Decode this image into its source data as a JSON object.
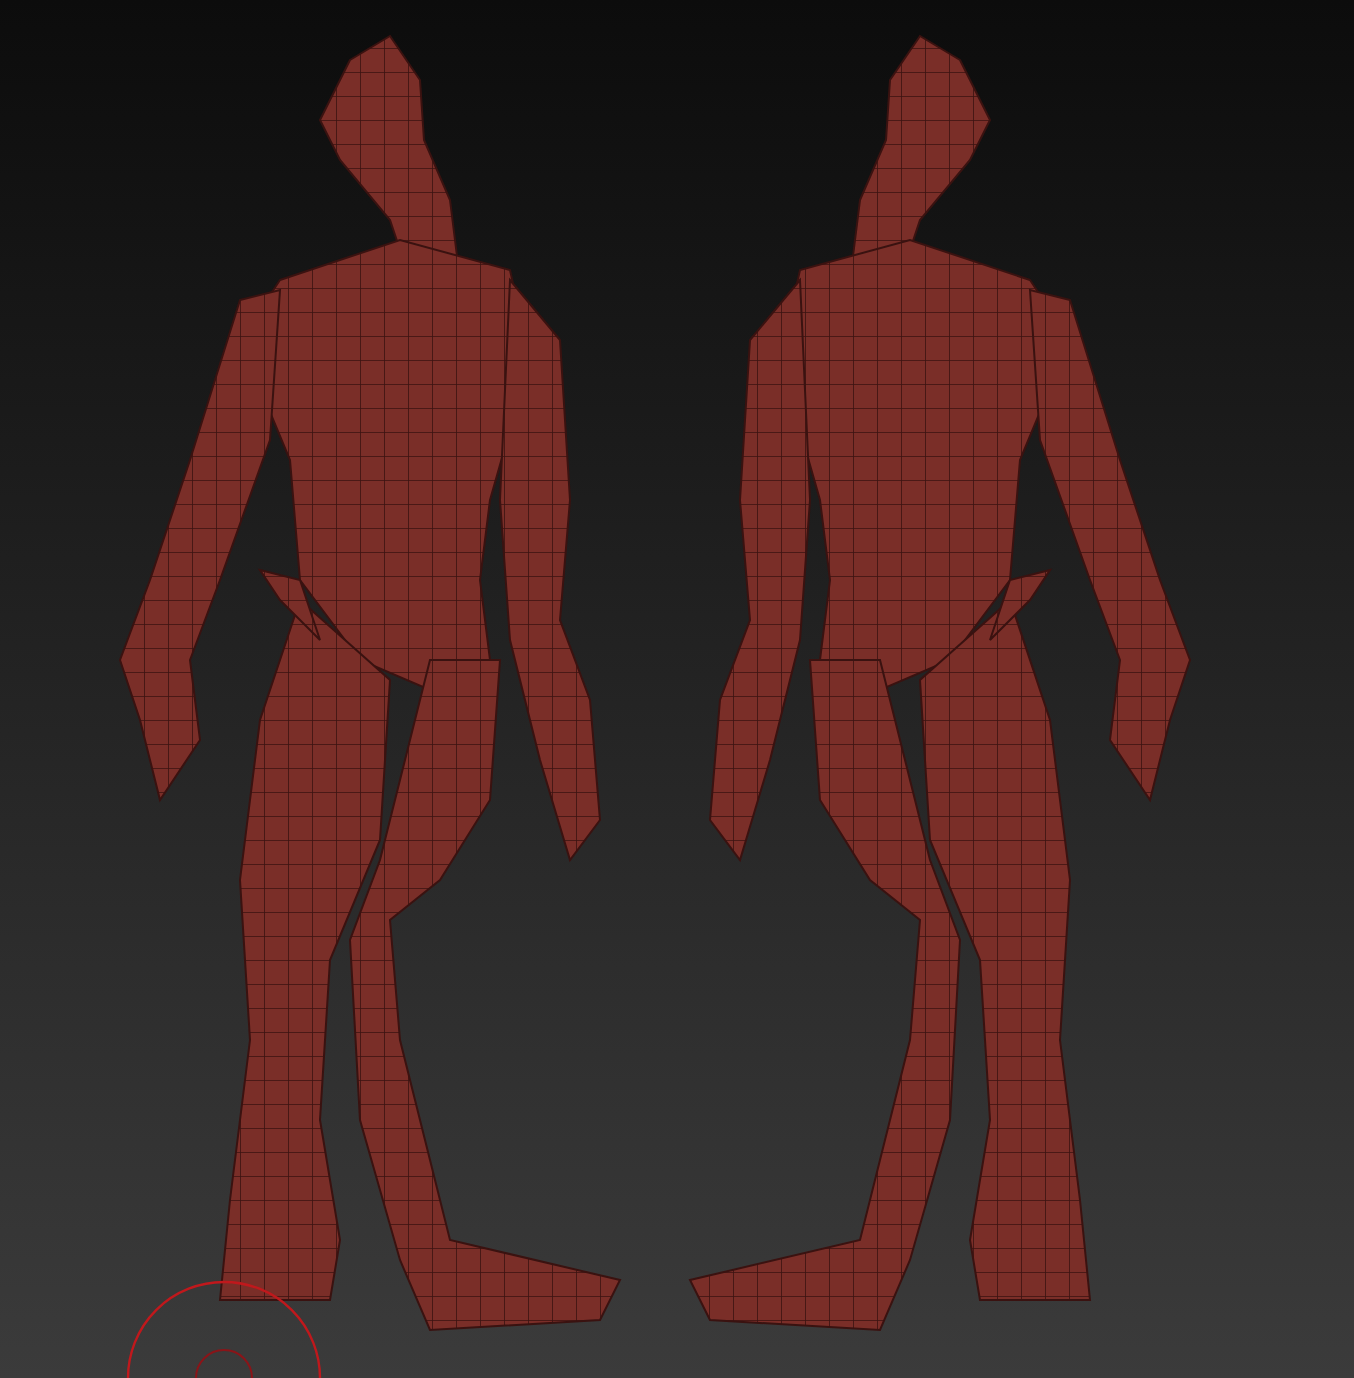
{
  "brush_cursor": {
    "visible": true
  }
}
